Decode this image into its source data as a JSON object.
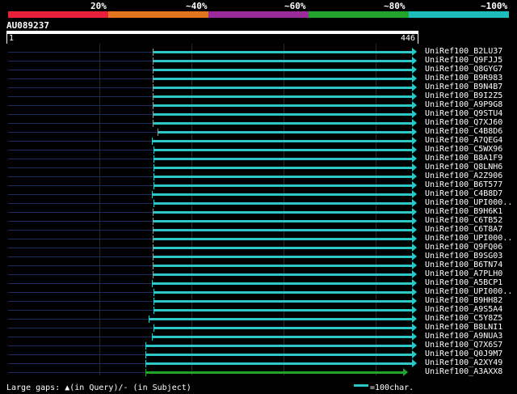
{
  "colorbar": {
    "segments": [
      {
        "color": "#e8203a",
        "label": "20%"
      },
      {
        "color": "#e2741d",
        "label": "~40%"
      },
      {
        "color": "#9b2b9b",
        "label": "~60%"
      },
      {
        "color": "#22a32c",
        "label": "~80%"
      },
      {
        "color": "#1fbcbc",
        "label": "~100%"
      }
    ]
  },
  "query": {
    "id": "AU089237",
    "start": "1",
    "end": "446",
    "length": 446
  },
  "hits": [
    {
      "name": "UniRef100_B2LU37",
      "start": 160,
      "end": 446,
      "color": "#2ec7c7"
    },
    {
      "name": "UniRef100_Q9FJJ5",
      "start": 160,
      "end": 446,
      "color": "#2ec7c7"
    },
    {
      "name": "UniRef100_Q8GYG7",
      "start": 160,
      "end": 446,
      "color": "#2ec7c7"
    },
    {
      "name": "UniRef100_B9R983",
      "start": 160,
      "end": 446,
      "color": "#2ec7c7"
    },
    {
      "name": "UniRef100_B9N4B7",
      "start": 160,
      "end": 446,
      "color": "#2ec7c7"
    },
    {
      "name": "UniRef100_B9I2Z5",
      "start": 160,
      "end": 446,
      "color": "#2ec7c7"
    },
    {
      "name": "UniRef100_A9P9G8",
      "start": 160,
      "end": 446,
      "color": "#2ec7c7"
    },
    {
      "name": "UniRef100_Q9STU4",
      "start": 160,
      "end": 446,
      "color": "#2ec7c7"
    },
    {
      "name": "UniRef100_Q7XJ60",
      "start": 160,
      "end": 446,
      "color": "#2ec7c7"
    },
    {
      "name": "UniRef100_C4B8D6",
      "start": 166,
      "end": 446,
      "color": "#2ec7c7"
    },
    {
      "name": "UniRef100_A7QEG4",
      "start": 159,
      "end": 446,
      "color": "#2ec7c7"
    },
    {
      "name": "UniRef100_C5WX96",
      "start": 161,
      "end": 446,
      "color": "#2ec7c7"
    },
    {
      "name": "UniRef100_B8A1F9",
      "start": 161,
      "end": 446,
      "color": "#2ec7c7"
    },
    {
      "name": "UniRef100_Q8LNH6",
      "start": 161,
      "end": 446,
      "color": "#2ec7c7"
    },
    {
      "name": "UniRef100_A2Z906",
      "start": 161,
      "end": 446,
      "color": "#2ec7c7"
    },
    {
      "name": "UniRef100_B6T577",
      "start": 161,
      "end": 446,
      "color": "#2ec7c7"
    },
    {
      "name": "UniRef100_C4B8D7",
      "start": 159,
      "end": 446,
      "color": "#2ec7c7"
    },
    {
      "name": "UniRef100_UPI000..",
      "start": 161,
      "end": 446,
      "color": "#2ec7c7"
    },
    {
      "name": "UniRef100_B9H6K1",
      "start": 160,
      "end": 446,
      "color": "#2ec7c7"
    },
    {
      "name": "UniRef100_C6TB52",
      "start": 160,
      "end": 446,
      "color": "#2ec7c7"
    },
    {
      "name": "UniRef100_C6T8A7",
      "start": 160,
      "end": 446,
      "color": "#2ec7c7"
    },
    {
      "name": "UniRef100_UPI000..",
      "start": 160,
      "end": 446,
      "color": "#2ec7c7"
    },
    {
      "name": "UniRef100_Q9FQ06",
      "start": 160,
      "end": 446,
      "color": "#2ec7c7"
    },
    {
      "name": "UniRef100_B9SG03",
      "start": 160,
      "end": 446,
      "color": "#2ec7c7"
    },
    {
      "name": "UniRef100_B6TN74",
      "start": 160,
      "end": 446,
      "color": "#2ec7c7"
    },
    {
      "name": "UniRef100_A7PLH0",
      "start": 160,
      "end": 446,
      "color": "#2ec7c7"
    },
    {
      "name": "UniRef100_A5BCP1",
      "start": 159,
      "end": 446,
      "color": "#2ec7c7"
    },
    {
      "name": "UniRef100_UPI000..",
      "start": 161,
      "end": 446,
      "color": "#2ec7c7"
    },
    {
      "name": "UniRef100_B9HH82",
      "start": 161,
      "end": 446,
      "color": "#2ec7c7"
    },
    {
      "name": "UniRef100_A9S5A4",
      "start": 161,
      "end": 446,
      "color": "#2ec7c7"
    },
    {
      "name": "UniRef100_C5Y8Z5",
      "start": 156,
      "end": 446,
      "color": "#2ec7c7"
    },
    {
      "name": "UniRef100_B8LNI1",
      "start": 161,
      "end": 446,
      "color": "#2ec7c7"
    },
    {
      "name": "UniRef100_A9NUA3",
      "start": 159,
      "end": 446,
      "color": "#2ec7c7"
    },
    {
      "name": "UniRef100_Q7X6S7",
      "start": 152,
      "end": 446,
      "color": "#2ec7c7"
    },
    {
      "name": "UniRef100_Q0J9M7",
      "start": 152,
      "end": 446,
      "color": "#2ec7c7"
    },
    {
      "name": "UniRef100_A2XY49",
      "start": 152,
      "end": 446,
      "color": "#2ec7c7"
    },
    {
      "name": "UniRef100_A3AXX8",
      "start": 152,
      "end": 436,
      "color": "#22a32c"
    }
  ],
  "legend": {
    "text": "Large gaps: ▲(in Query)/- (in Subject)",
    "scale_label": "=100char."
  }
}
